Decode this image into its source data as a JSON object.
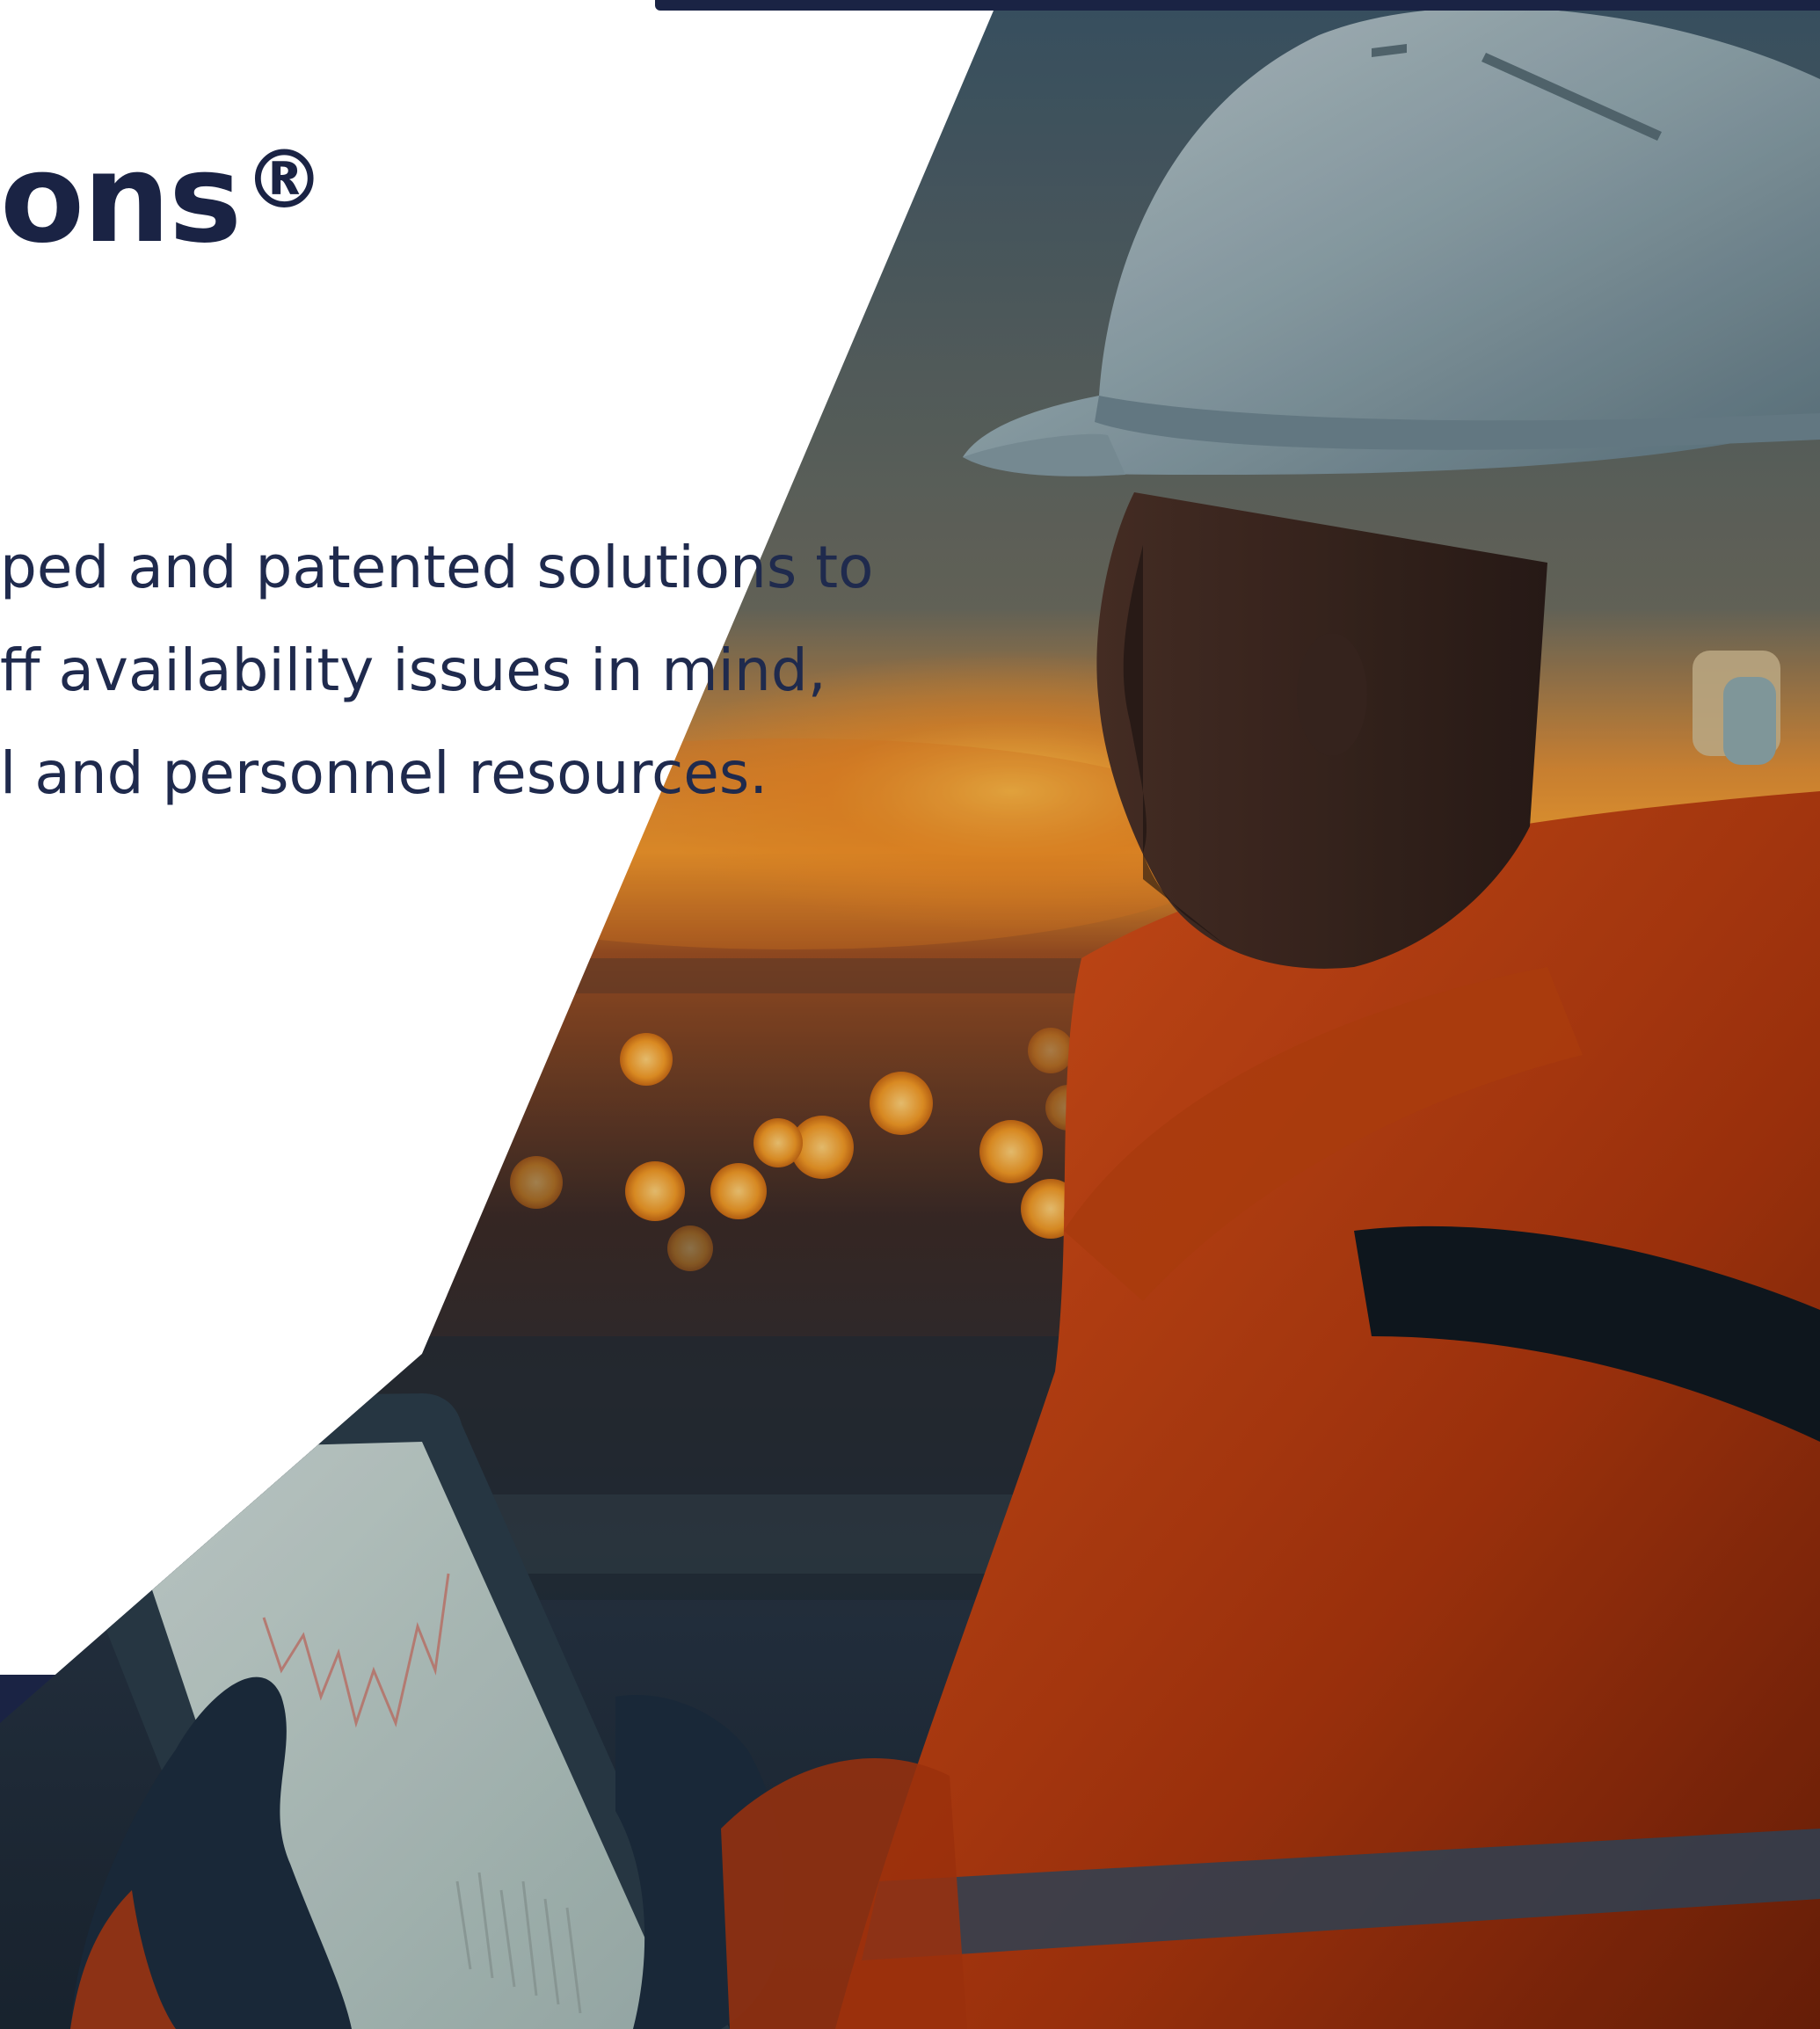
{
  "hero": {
    "headline": "ons",
    "headline_mark": "®",
    "body_lines": [
      "ped and patented solutions to",
      "ff availability issues in mind,",
      "l and personnel resources."
    ]
  },
  "colors": {
    "navy": "#1a2344",
    "text": "#1f2a4d",
    "safety_orange": "#c2400f",
    "sunset": "#f29a25"
  },
  "photo": {
    "subject": "worker-in-hard-hat-with-tablet"
  }
}
